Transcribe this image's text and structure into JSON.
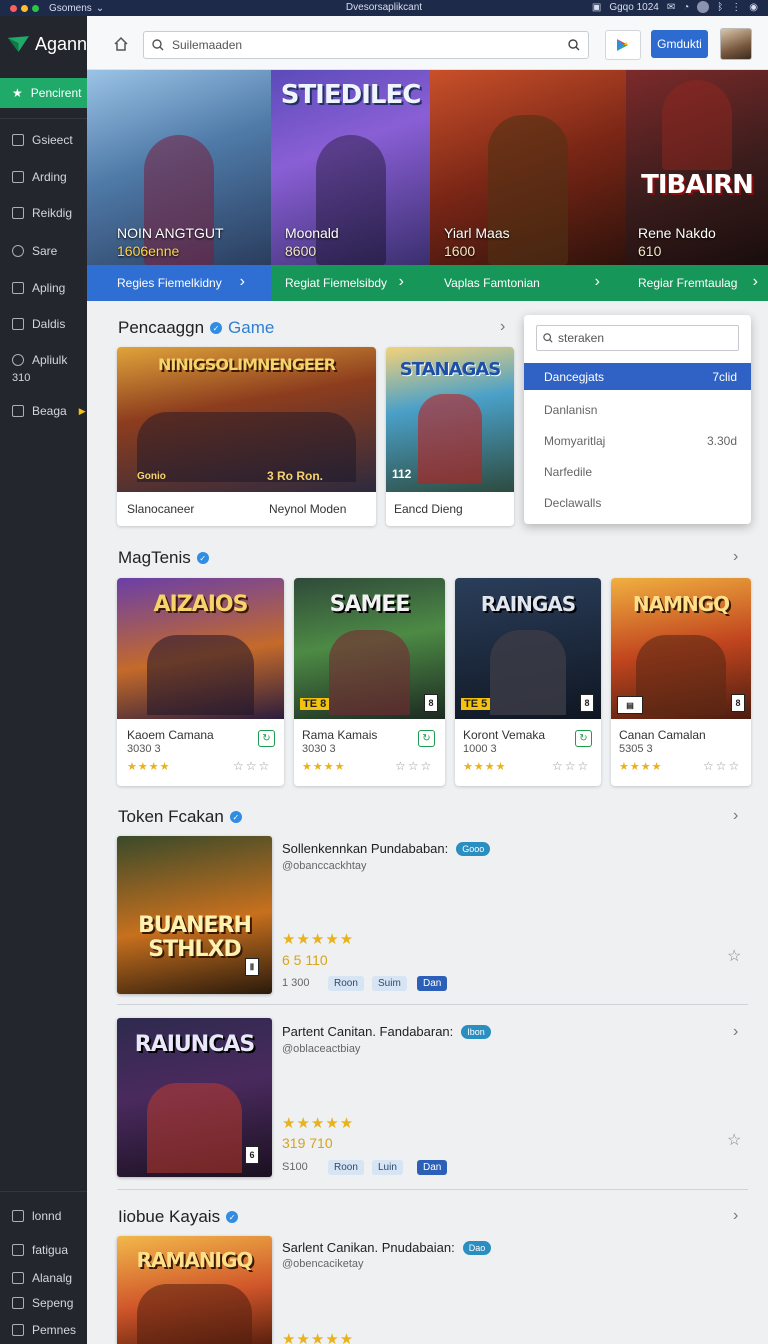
{
  "os_bar": {
    "app_menu": "Gsomens",
    "window_title": "Dvesorsaplikcant",
    "clock": "Ggqo 1024",
    "dot_colors": [
      "#ff5f57",
      "#febc2e",
      "#28c840"
    ]
  },
  "brand": {
    "name": "Agann",
    "color": "#1faa6a"
  },
  "sidebar": {
    "active": {
      "label": "Pencirent",
      "icon": "star-icon"
    },
    "items": [
      {
        "label": "Gsieect",
        "icon": "grid-icon"
      },
      {
        "label": "Arding",
        "icon": "image-icon"
      },
      {
        "label": "Reikdig",
        "icon": "tool-icon"
      },
      {
        "label": "Sare",
        "icon": "circle-icon"
      },
      {
        "label": "Apling",
        "icon": "users-icon"
      },
      {
        "label": "Daldis",
        "icon": "list-icon"
      },
      {
        "label": "Apliulk",
        "icon": "ring-icon",
        "sub": "310"
      },
      {
        "label": "Beaga",
        "icon": "info-icon"
      }
    ],
    "bottom_items": [
      {
        "label": "lonnd",
        "icon": "grid-icon"
      },
      {
        "label": "fatigua",
        "icon": "tool-icon"
      },
      {
        "label": "Alanalg",
        "icon": "controller-icon"
      },
      {
        "label": "Sepeng",
        "icon": "truck-icon"
      },
      {
        "label": "Pemnes",
        "icon": "image-icon"
      }
    ]
  },
  "header": {
    "search_placeholder": "Suilemaaden",
    "cta_label": "Gmdukti"
  },
  "hero": [
    {
      "art_title": "",
      "name": "NOIN ANGTGUT",
      "sub": "1606enne",
      "strip": "Regies Fiemelkidny",
      "strip_color": "#2f6fd3"
    },
    {
      "art_title": "STIEDILEC",
      "name": "Moonald",
      "sub": "8600",
      "strip": "Regiat Fiemelsibdy",
      "strip_color": "#17965a"
    },
    {
      "art_title": "",
      "name": "Yiarl Maas",
      "sub": "1600",
      "strip": "Vaplas Famtonian",
      "strip_color": "#17965a"
    },
    {
      "art_title": "TIBAIRN",
      "name": "Rene Nakdo",
      "sub": "610",
      "strip": "Regiar Fremtaulag",
      "strip_color": "#17965a"
    }
  ],
  "section1": {
    "title": "Pencaaggn",
    "accent": "Game",
    "cards": [
      {
        "art_title": "NINIGSOLIMNENGEER",
        "badge": "Gonio",
        "badge2": "3 Ro Ron.",
        "left": "Slanocaneer",
        "right": "Neynol Moden"
      },
      {
        "art_title": "STANAGAS",
        "badge": "112",
        "left": "Eancd Dieng",
        "right": ""
      }
    ]
  },
  "dropdown": {
    "placeholder": "steraken",
    "items": [
      {
        "label": "Dancegjats",
        "value": "7clid",
        "selected": true
      },
      {
        "label": "Danlanisn",
        "value": ""
      },
      {
        "label": "Momyaritlaj",
        "value": "3.30d"
      },
      {
        "label": "Narfedile",
        "value": ""
      },
      {
        "label": "Declawalls",
        "value": ""
      }
    ]
  },
  "section2": {
    "title": "MagTenis",
    "cards": [
      {
        "art_title": "AIZAIOS",
        "badge": "",
        "name": "Kaoem Camana",
        "meta": "3030 3",
        "rating_box": ""
      },
      {
        "art_title": "SAMEE",
        "badge": "TE 8",
        "name": "Rama Kamais",
        "meta": "3030 3",
        "rating_box": ""
      },
      {
        "art_title": "RAINGAS",
        "badge": "TE 5",
        "name": "Koront Vemaka",
        "meta": "1000 3",
        "rating_box": ""
      },
      {
        "art_title": "NAMNGQ",
        "badge": "",
        "name": "Canan Camalan",
        "meta": "5305 3",
        "rating_box": ""
      }
    ]
  },
  "section3": {
    "title": "Token Fcakan",
    "rows": [
      {
        "art_title": "BUANERH STHLXD",
        "title": "Sollenkennkan Pundababan:",
        "pill": "Gooo",
        "handle": "@obanccackhtay",
        "price": "6 5 110",
        "count": "1 300",
        "tags": [
          "Roon",
          "Suim",
          "Dan"
        ]
      },
      {
        "art_title": "RAIUNCAS",
        "title": "Partent Canitan. Fandabaran:",
        "pill": "Ibon",
        "handle": "@oblaceactbiay",
        "price": "319 710",
        "count": "S100",
        "tags": [
          "Roon",
          "Luin",
          "Dan"
        ]
      }
    ]
  },
  "section4": {
    "title": "Iiobue Kayais",
    "rows": [
      {
        "art_title": "RAMANIGQ",
        "title": "Sarlent Canikan. Pnudabaian:",
        "pill": "Dao",
        "handle": "@obencaciketay"
      }
    ]
  },
  "colors": {
    "accent_blue": "#2e6bd0",
    "accent_green": "#1faa6a",
    "star": "#e8b21c"
  }
}
